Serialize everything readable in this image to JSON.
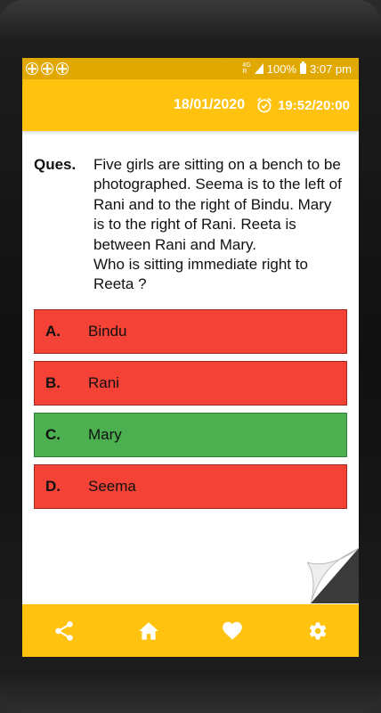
{
  "status_bar": {
    "net_top": "4G",
    "net_bottom": "R",
    "battery": "100%",
    "time": "3:07 pm"
  },
  "header": {
    "date": "18/01/2020",
    "timer": "19:52/20:00"
  },
  "question": {
    "label": "Ques.",
    "text": "Five girls are sitting on a bench to be photographed. Seema is to the left of Rani and to the right of Bindu. Mary is to the right of Rani. Reeta is between Rani and Mary.\nWho is sitting immediate right to Reeta ?"
  },
  "options": [
    {
      "letter": "A.",
      "text": "Bindu",
      "state": "wrong"
    },
    {
      "letter": "B.",
      "text": "Rani",
      "state": "wrong"
    },
    {
      "letter": "C.",
      "text": "Mary",
      "state": "correct"
    },
    {
      "letter": "D.",
      "text": "Seema",
      "state": "wrong"
    }
  ],
  "colors": {
    "header": "#ffc20e",
    "status_bar": "#e0a800",
    "wrong": "#f44336",
    "correct": "#4caf50"
  },
  "bottom_nav": [
    "share-icon",
    "home-icon",
    "heart-icon",
    "settings-icon"
  ]
}
